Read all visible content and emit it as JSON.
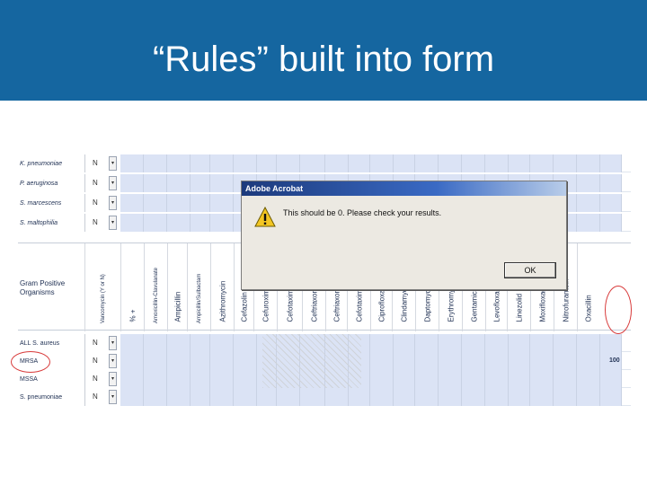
{
  "slide": {
    "title": "“Rules” built into form"
  },
  "top_rows": [
    {
      "organism": "K. pneumoniae",
      "code": "N"
    },
    {
      "organism": "P. aeruginosa",
      "code": "N"
    },
    {
      "organism": "S. marcescens",
      "code": "N"
    },
    {
      "organism": "S. maltophilia",
      "code": "N"
    }
  ],
  "gram_positive": {
    "label": "Gram Positive Organisms",
    "columns": [
      "Vancomycin (Y or N)",
      "% +",
      "Amoxicillin-Clavulanate",
      "Ampicillin",
      "Ampicillin/Sulbactam",
      "Azithromycin",
      "Cefazolin",
      "Cefuroxime ≤1 ug/ml",
      "Cefotaxime ≤0.5 ug/ml",
      "Ceftriaxone ≤2 ug/ml",
      "Ceftriaxone ≤0.5 ug/ml",
      "Cefotaxime",
      "Ciprofloxacin",
      "Clindamycin",
      "Daptomycin",
      "Erythromycin",
      "Gentamicin",
      "Levofloxacin",
      "Linezolid",
      "Moxifloxacin",
      "Nitrofurantoin",
      "Oxacillin"
    ],
    "rows": [
      {
        "organism": "ALL S. aureus",
        "code": "N"
      },
      {
        "organism": "MRSA",
        "code": "N"
      },
      {
        "organism": "MSSA",
        "code": "N"
      },
      {
        "organism": "S. pneumoniae",
        "code": "N"
      }
    ],
    "mrsa_oxacillin_value": "100"
  },
  "dialog": {
    "title": "Adobe Acrobat",
    "message": "This should be 0. Please check your results.",
    "ok_label": "OK",
    "icon": "warning-icon"
  },
  "dropdown_glyph": "▾",
  "colors": {
    "header": "#1566a0",
    "cell_blue": "#dbe3f5",
    "annotation_red": "#d83a3a",
    "dialog_titlebar": "#1c3a7c"
  }
}
